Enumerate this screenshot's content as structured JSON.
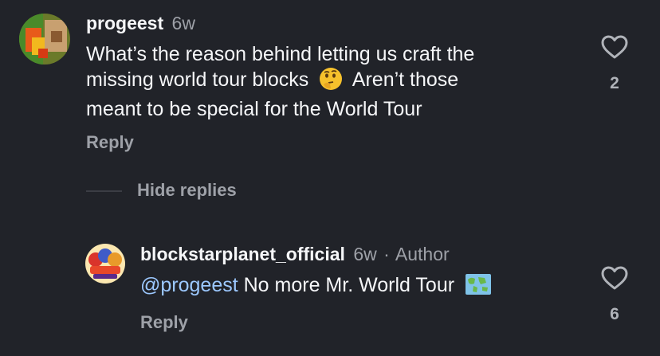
{
  "comment": {
    "username": "progeest",
    "age": "6w",
    "text_line1": "What’s the reason behind letting us craft the",
    "text_line2a": "missing world tour blocks",
    "text_line2b": "Aren’t those",
    "text_line3": "meant to be special for the World Tour",
    "reply_label": "Reply",
    "likes": "2",
    "emoji_icon": "thinking-face-icon"
  },
  "hide_replies_label": "Hide replies",
  "reply": {
    "username": "blockstarplanet_official",
    "age": "6w",
    "separator": "·",
    "author_badge": "Author",
    "mention": "@progeest",
    "text": "No more Mr. World Tour",
    "reply_label": "Reply",
    "likes": "6",
    "emoji_icon": "world-map-icon"
  },
  "colors": {
    "background": "#212329",
    "muted": "#9ea1a8",
    "mention": "#9cc8ff"
  }
}
